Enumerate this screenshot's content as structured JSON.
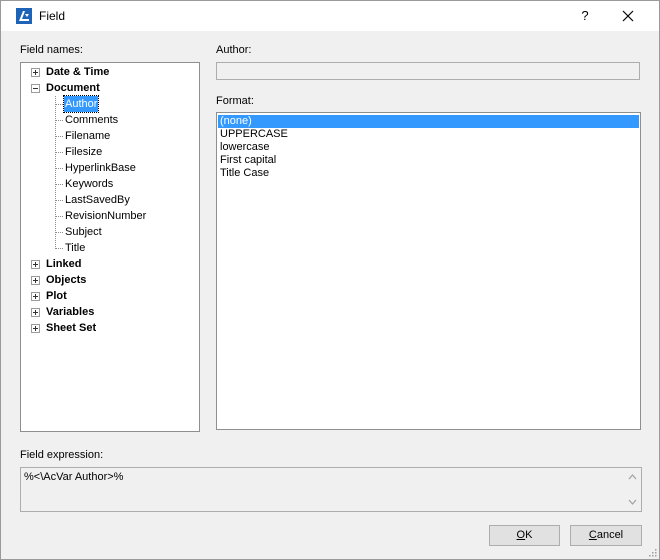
{
  "window": {
    "title": "Field",
    "help_glyph": "?",
    "icons": {
      "app": "app-logo-icon",
      "close": "close-icon"
    }
  },
  "labels": {
    "field_names": "Field names:",
    "author": "Author:",
    "format": "Format:",
    "field_expression": "Field expression:"
  },
  "tree": {
    "categories": [
      {
        "label": "Date & Time",
        "expanded": false
      },
      {
        "label": "Document",
        "expanded": true
      },
      {
        "label": "Linked",
        "expanded": false
      },
      {
        "label": "Objects",
        "expanded": false
      },
      {
        "label": "Plot",
        "expanded": false
      },
      {
        "label": "Variables",
        "expanded": false
      },
      {
        "label": "Sheet Set",
        "expanded": false
      }
    ],
    "document_children": [
      "Author",
      "Comments",
      "Filename",
      "Filesize",
      "HyperlinkBase",
      "Keywords",
      "LastSavedBy",
      "RevisionNumber",
      "Subject",
      "Title"
    ],
    "selected": "Author"
  },
  "author_value": "",
  "format": {
    "options": [
      "(none)",
      "UPPERCASE",
      "lowercase",
      "First capital",
      "Title Case"
    ],
    "selected": "(none)"
  },
  "expression": "%<\\AcVar Author>%",
  "buttons": {
    "ok": {
      "accel": "O",
      "rest": "K"
    },
    "cancel": {
      "accel": "C",
      "rest": "ancel"
    }
  },
  "colors": {
    "selection": "#3399ff",
    "app_icon": "#1d63b8"
  }
}
